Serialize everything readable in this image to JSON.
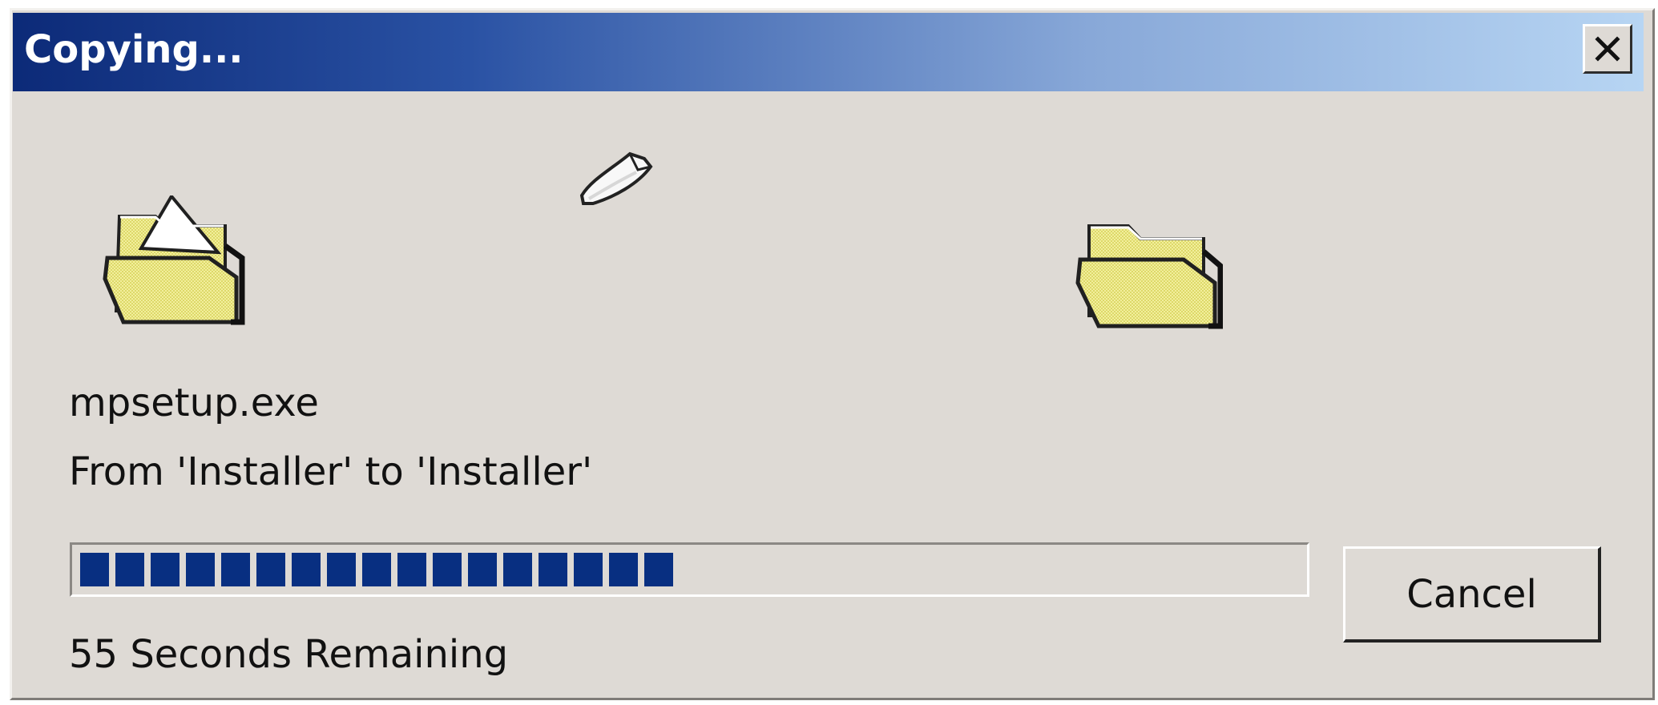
{
  "window": {
    "title": "Copying...",
    "close_label": "X"
  },
  "icons": {
    "source_folder": "open-folder-icon",
    "flying_document": "document-icon",
    "target_folder": "folder-icon",
    "close": "close-icon"
  },
  "copy": {
    "file_name": "mpsetup.exe",
    "path_text": "From 'Installer' to 'Installer'",
    "time_remaining": "55 Seconds Remaining",
    "progress_percent": 50
  },
  "buttons": {
    "cancel_label": "Cancel"
  },
  "colors": {
    "title_gradient_start": "#0c2a78",
    "title_gradient_end": "#b7d5f3",
    "dialog_face": "#dedad5",
    "progress": "#082f81",
    "folder": "#f2ef9c"
  }
}
